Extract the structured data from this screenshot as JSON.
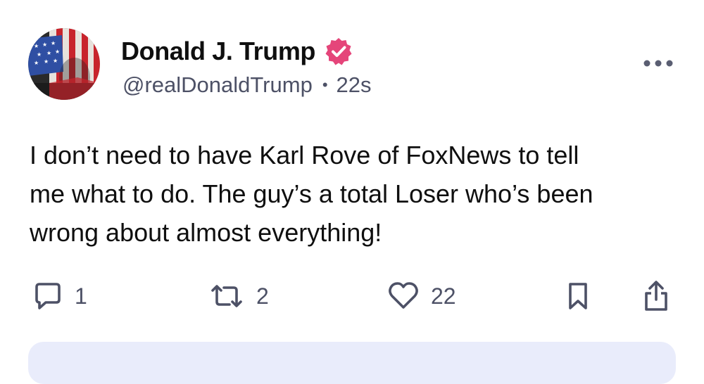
{
  "post": {
    "author": {
      "display_name": "Donald J. Trump",
      "handle": "@realDonaldTrump",
      "verified": true,
      "verified_color": "#e5457a"
    },
    "timestamp": "22s",
    "separator": "•",
    "text_lines": [
      "I don’t need to have Karl Rove of FoxNews to tell",
      "me what to do. The guy’s a total Loser who’s been",
      "wrong about almost everything!"
    ],
    "actions": {
      "replies": "1",
      "reposts": "2",
      "likes": "22"
    },
    "icons": [
      "verified-badge-icon",
      "more-options-icon",
      "reply-icon",
      "repost-icon",
      "like-icon",
      "bookmark-icon",
      "share-icon"
    ],
    "colors": {
      "text": "#0f0f0f",
      "muted": "#4d5166",
      "accent_bar": "#e9ecfb"
    }
  }
}
